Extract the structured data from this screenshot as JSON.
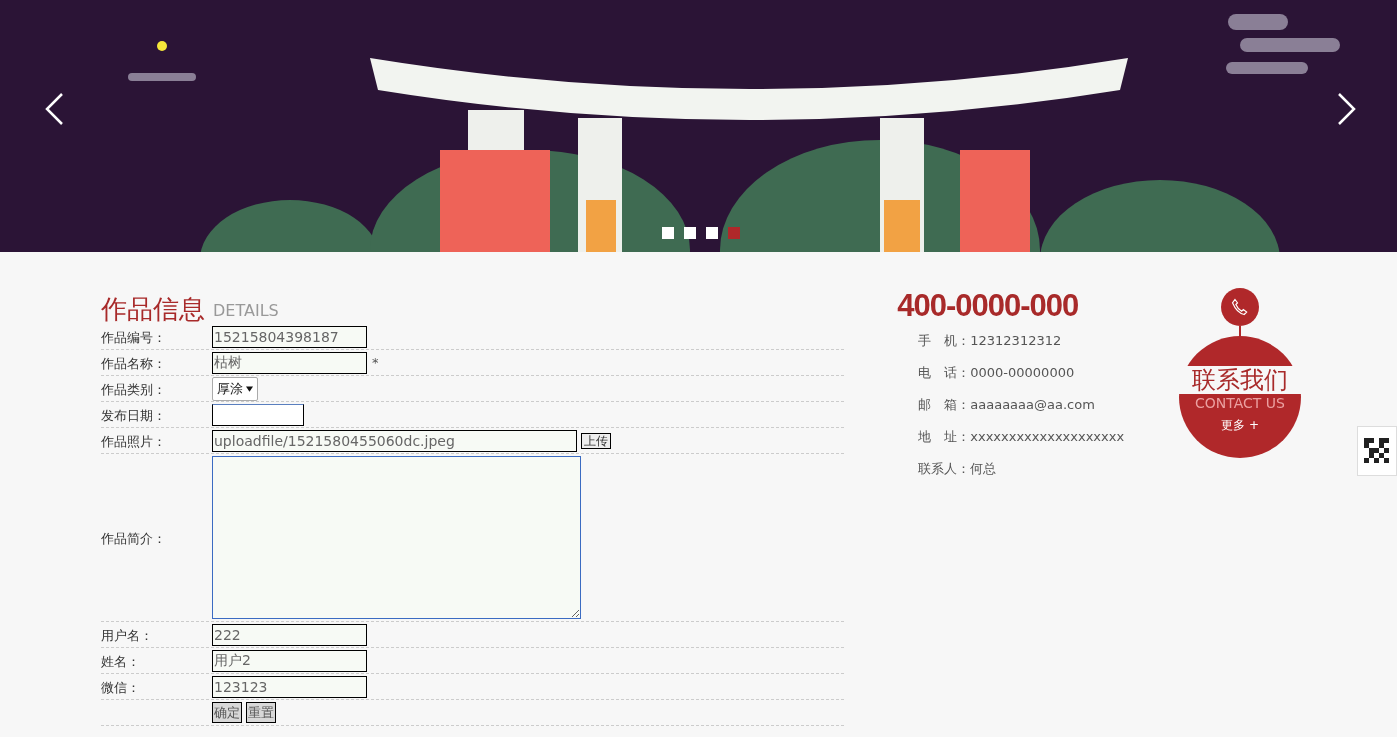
{
  "banner": {
    "kind": "picture",
    "dots": [
      {
        "selected": false
      },
      {
        "selected": false
      },
      {
        "selected": false
      },
      {
        "selected": true
      }
    ]
  },
  "form": {
    "title": "作品信息",
    "subtitle": "DETAILS",
    "rows": [
      {
        "kind": "text",
        "label": "作品编号：",
        "value": "15215804398187"
      },
      {
        "kind": "text",
        "label": "作品名称：",
        "value": "枯树",
        "required": "*"
      },
      {
        "kind": "select",
        "label": "作品类别：",
        "value": "厚涂"
      },
      {
        "kind": "date",
        "label": "发布日期："
      },
      {
        "kind": "file",
        "label": "作品照片：",
        "value": "uploadfile/1521580455060dc.jpeg",
        "button": "上传"
      },
      {
        "kind": "textarea",
        "label": "作品简介："
      },
      {
        "kind": "text",
        "label": "用户名：",
        "value": "222"
      },
      {
        "kind": "text",
        "label": "姓名：",
        "value": "用户2"
      },
      {
        "kind": "text",
        "label": "微信：",
        "value": "123123"
      },
      {
        "kind": "buttons",
        "buttons": [
          "确定",
          "重置"
        ]
      }
    ]
  },
  "contact": {
    "hotline": "400-0000-000",
    "items": [
      "手　机：12312312312",
      "电　话：0000-00000000",
      "邮　箱：aaaaaaaa@aa.com",
      "地　址：xxxxxxxxxxxxxxxxxxxx",
      "联系人：何总"
    ],
    "badge": {
      "title": "联系我们",
      "subtitle": "CONTACT US",
      "more": "更多 +"
    }
  }
}
